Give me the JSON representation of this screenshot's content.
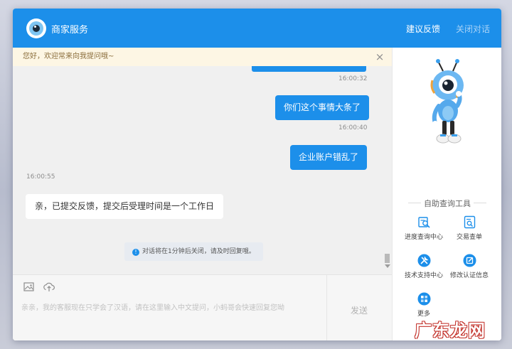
{
  "header": {
    "title": "商家服务",
    "feedback_label": "建议反馈",
    "close_label": "关闭对话"
  },
  "notice": {
    "text": "您好，欢迎常来向我提问哦~",
    "close_icon": "×"
  },
  "messages": [
    {
      "type": "out",
      "time": "16:00:32",
      "text": "你们这个事情大条了"
    },
    {
      "type": "out",
      "time": "16:00:40",
      "text": "企业账户错乱了"
    },
    {
      "type": "in",
      "time": "16:00:55",
      "text": "亲，已提交反馈，提交后受理时间是一个工作日"
    }
  ],
  "system_notice": {
    "icon": "!",
    "text": "对话将在1分钟后关闭，请及时回复哦。"
  },
  "composer": {
    "placeholder": "亲亲，我的客服现在只学会了汉语，请在这里输入中文提问，小蚂哥会快速回复您呦",
    "send_label": "发送"
  },
  "sidebar": {
    "tools_title": "自助查询工具",
    "tools": [
      {
        "label": "进度查询中心",
        "icon": "progress-search-icon"
      },
      {
        "label": "交易查单",
        "icon": "transaction-search-icon"
      },
      {
        "label": "技术支持中心",
        "icon": "wrench-icon"
      },
      {
        "label": "修改认证信息",
        "icon": "edit-icon"
      },
      {
        "label": "更多",
        "icon": "more-icon"
      }
    ]
  },
  "watermark": "广东龙网",
  "colors": {
    "primary": "#1c8fea",
    "chat_background": "#f0f0f0",
    "notice_background": "#fdf6e4"
  }
}
